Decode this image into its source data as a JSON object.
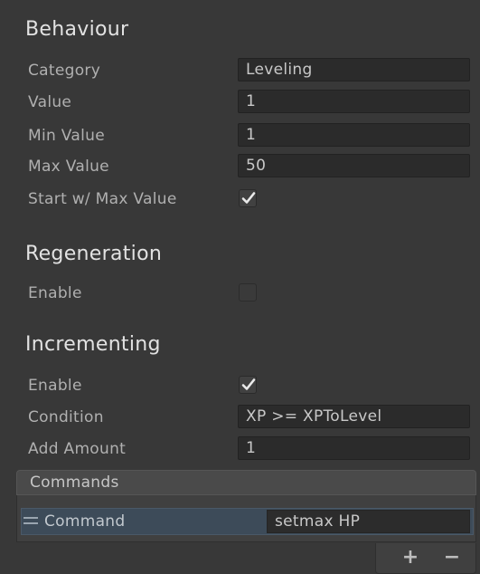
{
  "behaviour": {
    "title": "Behaviour",
    "fields": [
      {
        "label": "Category",
        "value": "Leveling"
      },
      {
        "label": "Value",
        "value": "1"
      },
      {
        "label": "Min Value",
        "value": "1"
      },
      {
        "label": "Max Value",
        "value": "50"
      }
    ],
    "start_max": {
      "label": "Start w/ Max Value",
      "checked": true
    }
  },
  "regeneration": {
    "title": "Regeneration",
    "enable": {
      "label": "Enable",
      "checked": false
    }
  },
  "incrementing": {
    "title": "Incrementing",
    "enable": {
      "label": "Enable",
      "checked": true
    },
    "condition": {
      "label": "Condition",
      "value": "XP >= XPToLevel"
    },
    "add_amount": {
      "label": "Add Amount",
      "value": "1"
    }
  },
  "commands": {
    "header": "Commands",
    "items": [
      {
        "label": "Command",
        "value": "setmax HP"
      }
    ],
    "add_label": "+",
    "remove_label": "−"
  },
  "colors": {
    "background": "#383838",
    "field_bg": "#2b2b2b",
    "selected_row": "#3d4b59"
  }
}
